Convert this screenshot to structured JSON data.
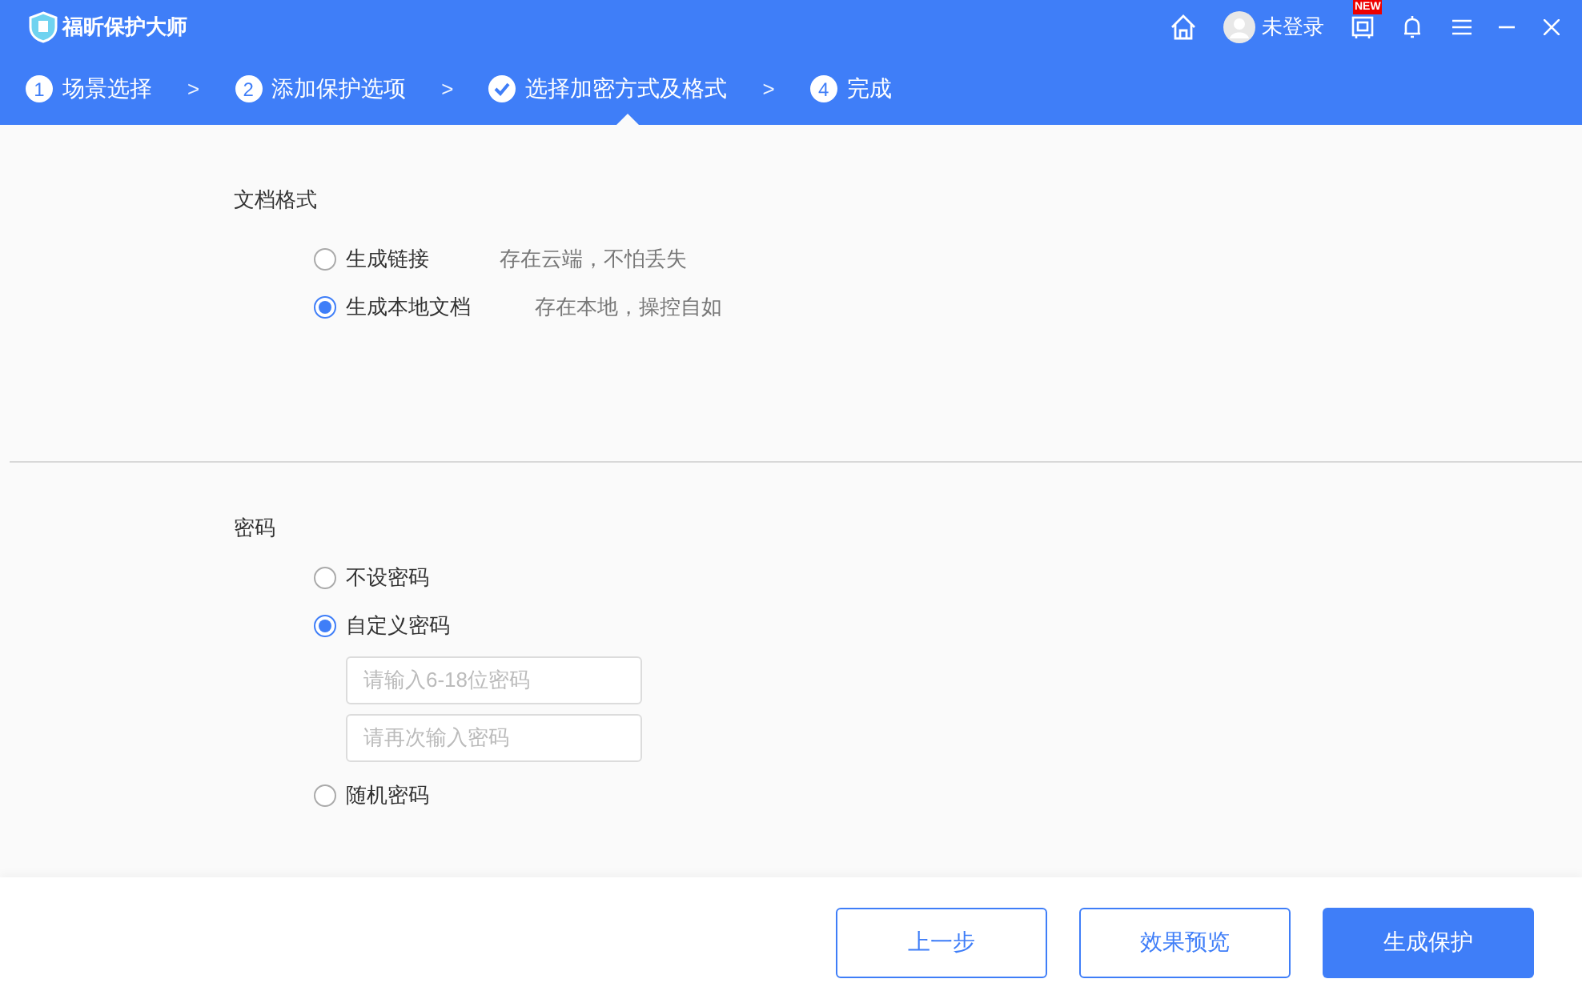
{
  "app": {
    "title": "福昕保护大师",
    "user": "未登录",
    "new_badge": "NEW"
  },
  "steps": [
    {
      "number": "1",
      "label": "场景选择",
      "selected": false
    },
    {
      "number": "2",
      "label": "添加保护选项",
      "selected": false
    },
    {
      "label": "选择加密方式及格式",
      "selected": true
    },
    {
      "number": "4",
      "label": "完成",
      "selected": false
    }
  ],
  "separator": ">",
  "format": {
    "title": "文档格式",
    "options": [
      {
        "label": "生成链接",
        "note": "存在云端，不怕丢失",
        "selected": false
      },
      {
        "label": "生成本地文档",
        "note": "存在本地，操控自如",
        "selected": true
      }
    ]
  },
  "password": {
    "title": "密码",
    "options": [
      {
        "label": "不设密码",
        "selected": false
      },
      {
        "label": "自定义密码",
        "selected": true,
        "fields": [
          {
            "placeholder": "请输入6-18位密码"
          },
          {
            "placeholder": "请再次输入密码"
          }
        ]
      },
      {
        "label": "随机密码",
        "selected": false
      }
    ]
  },
  "buttons": [
    {
      "label": "上一步",
      "kind": "outline"
    },
    {
      "label": "效果预览",
      "kind": "outline"
    },
    {
      "label": "生成保护",
      "kind": "primary"
    }
  ]
}
